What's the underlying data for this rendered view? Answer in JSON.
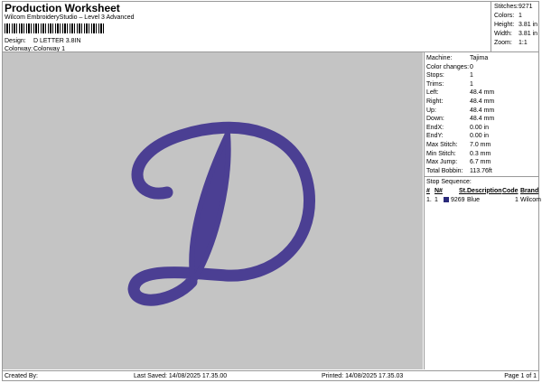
{
  "header": {
    "title": "Production Worksheet",
    "subtitle": "Wilcom EmbroideryStudio – Level 3 Advanced",
    "design_label": "Design:",
    "design_value": "D LETTER 3.8IN",
    "colorway_label": "Colorway:",
    "colorway_value": "Colorway 1"
  },
  "stats": [
    {
      "k": "Stitches:",
      "v": "9271"
    },
    {
      "k": "Colors:",
      "v": "1"
    },
    {
      "k": "Height:",
      "v": "3.81 in"
    },
    {
      "k": "Width:",
      "v": "3.81 in"
    },
    {
      "k": "Zoom:",
      "v": "1:1"
    }
  ],
  "details": [
    {
      "k": "Machine:",
      "v": "Tajima"
    },
    {
      "k": "Color changes:",
      "v": "0"
    },
    {
      "k": "Stops:",
      "v": "1"
    },
    {
      "k": "Trims:",
      "v": "1"
    },
    {
      "k": "Left:",
      "v": "48.4 mm"
    },
    {
      "k": "Right:",
      "v": "48.4 mm"
    },
    {
      "k": "Up:",
      "v": "48.4 mm"
    },
    {
      "k": "Down:",
      "v": "48.4 mm"
    },
    {
      "k": "EndX:",
      "v": "0.00 in"
    },
    {
      "k": "EndY:",
      "v": "0.00 in"
    },
    {
      "k": "Max Stitch:",
      "v": "7.0 mm"
    },
    {
      "k": "Min Stitch:",
      "v": "0.3 mm"
    },
    {
      "k": "Max Jump:",
      "v": "6.7 mm"
    },
    {
      "k": "Total Bobbin:",
      "v": "113.76ft"
    }
  ],
  "stop_sequence": {
    "title": "Stop Sequence:",
    "headers": [
      "#",
      "N#",
      "St.",
      "Description",
      "Code",
      "Brand"
    ],
    "rows": [
      {
        "num": "1.",
        "n": "1",
        "st": "9269",
        "desc": "Blue",
        "code": "1",
        "brand": "Wilcom",
        "color": "#2a2a7a"
      }
    ]
  },
  "design": {
    "thread_color": "#4b3f93"
  },
  "footer": {
    "created_by": "Created By:",
    "last_saved": "Last Saved: 14/08/2025 17.35.00",
    "printed": "Printed: 14/08/2025 17.35.03",
    "page": "Page 1 of 1"
  }
}
